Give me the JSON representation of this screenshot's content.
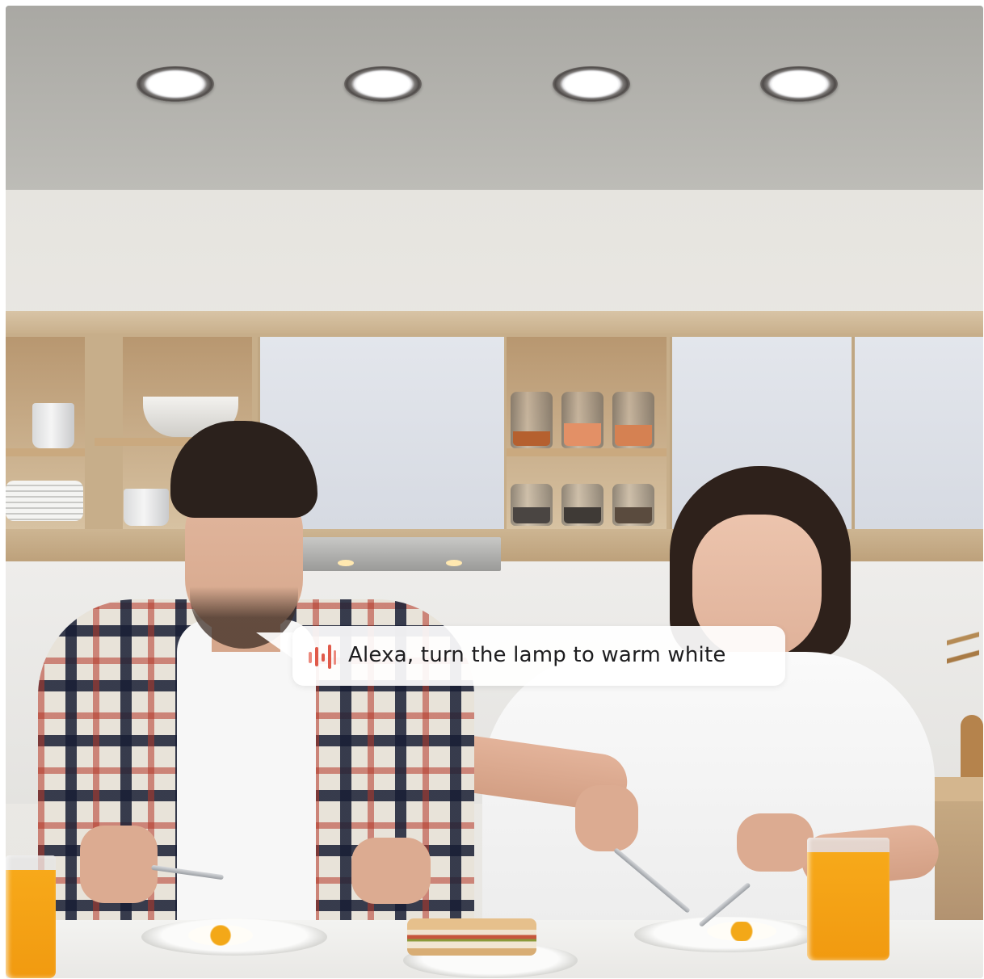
{
  "image": {
    "scene": "kitchen",
    "downlight_count": 4
  },
  "speech_bubble": {
    "text": "Alexa, turn the lamp to warm white",
    "icon": "voice-waveform-icon",
    "icon_color": "#e05a4a"
  }
}
